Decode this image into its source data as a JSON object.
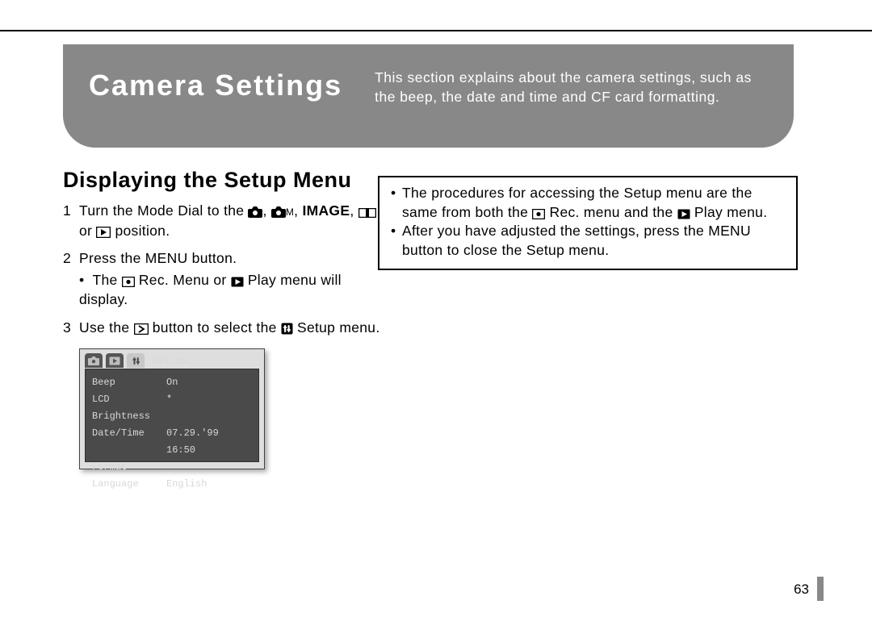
{
  "header": {
    "title": "Camera Settings",
    "intro": "This section explains about the camera settings, such as the beep, the date and time and CF card formatting."
  },
  "section_heading": "Displaying the Setup Menu",
  "steps": {
    "s1_a": "Turn the Mode Dial to the ",
    "s1_b": ", ",
    "s1_m": "M",
    "s1_c": ", ",
    "s1_image": "IMAGE",
    "s1_d": ", ",
    "s1_e": " or ",
    "s1_f": " position.",
    "s2": "Press the MENU button.",
    "s2_sub_a": "The ",
    "s2_sub_b": " Rec. Menu or ",
    "s2_sub_c": " Play menu will display.",
    "s3_a": "Use the ",
    "s3_b": " button to select the ",
    "s3_c": " Setup menu."
  },
  "notes": {
    "n1_a": "The procedures for accessing the Setup menu are the same from both the ",
    "n1_b": " Rec. menu and the ",
    "n1_c": " Play menu.",
    "n2": "After you have adjusted the settings, press the MENU button to close the Setup menu."
  },
  "lcd": {
    "tab_label": "Set up",
    "rows": [
      {
        "k": "Beep",
        "v": "On"
      },
      {
        "k": "LCD Brightness",
        "v": "*"
      },
      {
        "k": "Date/Time",
        "v": "07.29.'99 16:50"
      },
      {
        "k": "Format",
        "v": ""
      },
      {
        "k": "Language",
        "v": "English"
      }
    ]
  },
  "page_number": "63"
}
